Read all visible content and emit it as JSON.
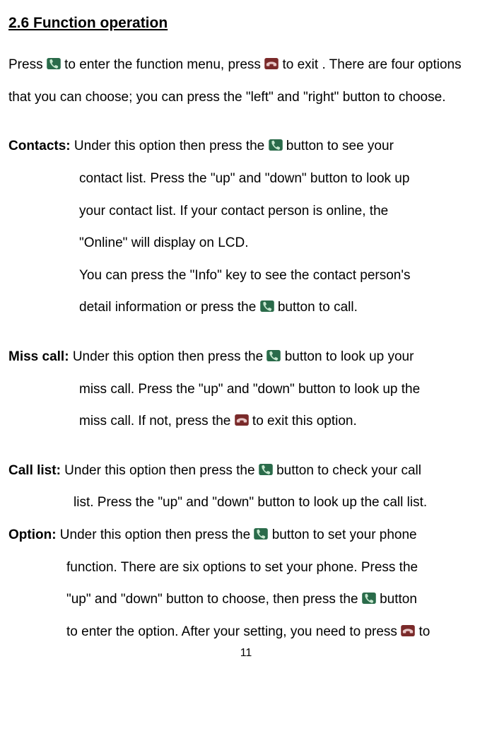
{
  "heading": "2.6  Function operation",
  "intro": {
    "p1a": "Press ",
    "p1b": " to enter the function menu, press ",
    "p1c": " to exit . There are four options that you can choose; you can press the \"left\" and \"right\" button to choose."
  },
  "contacts": {
    "label": "Contacts:",
    "line1a": " Under this option then press the ",
    "line1b": " button to see your",
    "line2": "contact list. Press the \"up\" and \"down\" button to look up",
    "line3": "your contact list. If your contact person is online, the",
    "line4": "\"Online\" will display on LCD.",
    "line5": "You can press the \"Info\" key to see the contact person's",
    "line6a": "detail information or press the ",
    "line6b": " button to call."
  },
  "misscall": {
    "label": "Miss call:",
    "line1a": " Under this option then press the ",
    "line1b": " button to look up your",
    "line2": "miss call. Press the \"up\" and \"down\" button to look up the",
    "line3a": "miss call. If not, press the ",
    "line3b": " to exit this option."
  },
  "calllist": {
    "label": "Call list:",
    "line1a": " Under this option then press the ",
    "line1b": " button to check your call",
    "line2": "list. Press the \"up\" and \"down\" button to look up the call list."
  },
  "option": {
    "label": "Option:",
    "line1a": " Under this option then press the ",
    "line1b": " button to set your phone",
    "line2": "function. There are six options to set your phone. Press the",
    "line3a": "\"up\" and \"down\" button to choose, then press the ",
    "line3b": " button",
    "line4a": "to enter the option. After your setting, you need to press ",
    "line4b": " to"
  },
  "page": "11",
  "icons": {
    "green_phone": "phone-dial-icon",
    "red_phone": "phone-hangup-icon"
  }
}
